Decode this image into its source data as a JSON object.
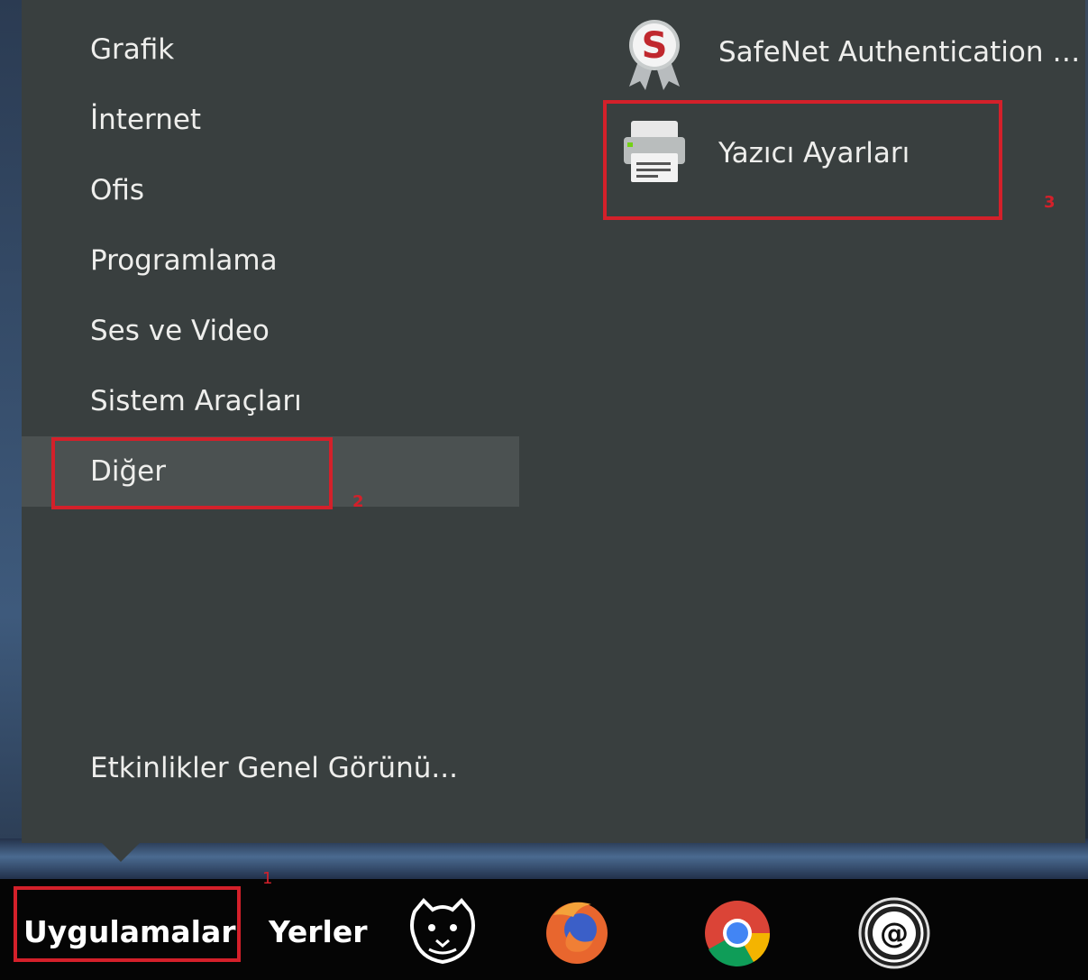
{
  "menu": {
    "categories": [
      {
        "label": "Grafik"
      },
      {
        "label": "İnternet"
      },
      {
        "label": "Ofis"
      },
      {
        "label": "Programlama"
      },
      {
        "label": "Ses ve Video"
      },
      {
        "label": "Sistem Araçları"
      },
      {
        "label": "Diğer"
      }
    ],
    "active_category": "Diğer",
    "overview_label": "Etkinlikler Genel Görünü...",
    "apps": [
      {
        "label": "SafeNet Authentication Client Tools",
        "icon": "safenet-icon"
      },
      {
        "label": "Yazıcı Ayarları",
        "icon": "printer-icon"
      }
    ]
  },
  "panel": {
    "applications_label": "Uygulamalar",
    "places_label": "Yerler",
    "launchers": [
      {
        "name": "pardus-icon"
      },
      {
        "name": "firefox-icon"
      },
      {
        "name": "chrome-icon"
      },
      {
        "name": "email-icon"
      }
    ]
  },
  "annotations": {
    "step1": "1",
    "step2": "2",
    "step3": "3",
    "color": "#d4202a"
  },
  "colors": {
    "menu_bg": "#393f3f",
    "active_bg": "#4b5151",
    "panel_bg": "#050505"
  }
}
